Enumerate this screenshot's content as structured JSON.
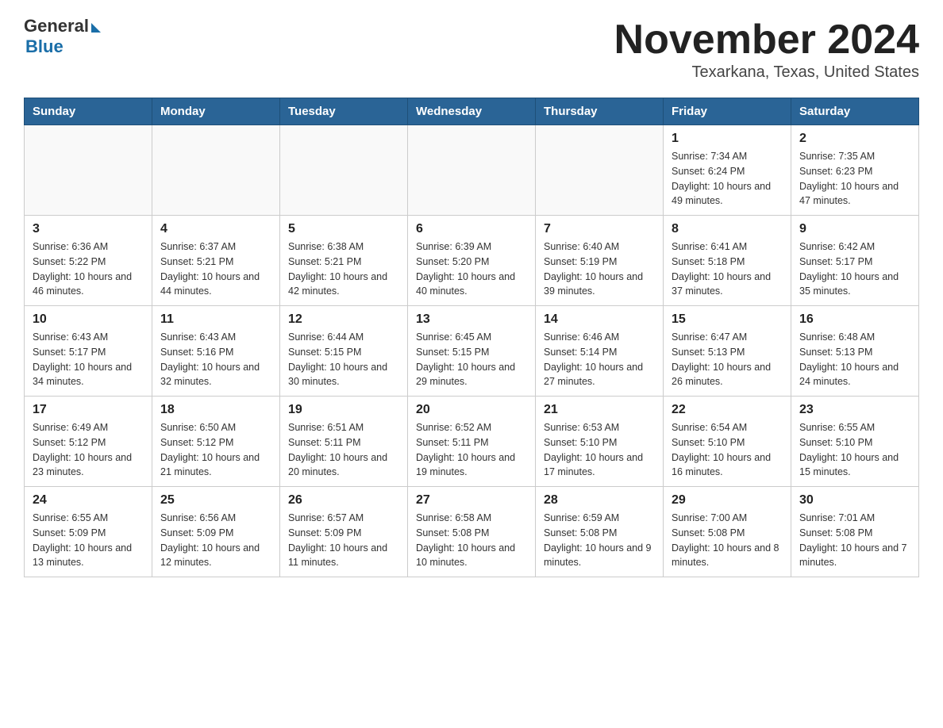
{
  "header": {
    "logo_general": "General",
    "logo_blue": "Blue",
    "month_title": "November 2024",
    "location": "Texarkana, Texas, United States"
  },
  "days_of_week": [
    "Sunday",
    "Monday",
    "Tuesday",
    "Wednesday",
    "Thursday",
    "Friday",
    "Saturday"
  ],
  "weeks": [
    [
      {
        "num": "",
        "sunrise": "",
        "sunset": "",
        "daylight": ""
      },
      {
        "num": "",
        "sunrise": "",
        "sunset": "",
        "daylight": ""
      },
      {
        "num": "",
        "sunrise": "",
        "sunset": "",
        "daylight": ""
      },
      {
        "num": "",
        "sunrise": "",
        "sunset": "",
        "daylight": ""
      },
      {
        "num": "",
        "sunrise": "",
        "sunset": "",
        "daylight": ""
      },
      {
        "num": "1",
        "sunrise": "Sunrise: 7:34 AM",
        "sunset": "Sunset: 6:24 PM",
        "daylight": "Daylight: 10 hours and 49 minutes."
      },
      {
        "num": "2",
        "sunrise": "Sunrise: 7:35 AM",
        "sunset": "Sunset: 6:23 PM",
        "daylight": "Daylight: 10 hours and 47 minutes."
      }
    ],
    [
      {
        "num": "3",
        "sunrise": "Sunrise: 6:36 AM",
        "sunset": "Sunset: 5:22 PM",
        "daylight": "Daylight: 10 hours and 46 minutes."
      },
      {
        "num": "4",
        "sunrise": "Sunrise: 6:37 AM",
        "sunset": "Sunset: 5:21 PM",
        "daylight": "Daylight: 10 hours and 44 minutes."
      },
      {
        "num": "5",
        "sunrise": "Sunrise: 6:38 AM",
        "sunset": "Sunset: 5:21 PM",
        "daylight": "Daylight: 10 hours and 42 minutes."
      },
      {
        "num": "6",
        "sunrise": "Sunrise: 6:39 AM",
        "sunset": "Sunset: 5:20 PM",
        "daylight": "Daylight: 10 hours and 40 minutes."
      },
      {
        "num": "7",
        "sunrise": "Sunrise: 6:40 AM",
        "sunset": "Sunset: 5:19 PM",
        "daylight": "Daylight: 10 hours and 39 minutes."
      },
      {
        "num": "8",
        "sunrise": "Sunrise: 6:41 AM",
        "sunset": "Sunset: 5:18 PM",
        "daylight": "Daylight: 10 hours and 37 minutes."
      },
      {
        "num": "9",
        "sunrise": "Sunrise: 6:42 AM",
        "sunset": "Sunset: 5:17 PM",
        "daylight": "Daylight: 10 hours and 35 minutes."
      }
    ],
    [
      {
        "num": "10",
        "sunrise": "Sunrise: 6:43 AM",
        "sunset": "Sunset: 5:17 PM",
        "daylight": "Daylight: 10 hours and 34 minutes."
      },
      {
        "num": "11",
        "sunrise": "Sunrise: 6:43 AM",
        "sunset": "Sunset: 5:16 PM",
        "daylight": "Daylight: 10 hours and 32 minutes."
      },
      {
        "num": "12",
        "sunrise": "Sunrise: 6:44 AM",
        "sunset": "Sunset: 5:15 PM",
        "daylight": "Daylight: 10 hours and 30 minutes."
      },
      {
        "num": "13",
        "sunrise": "Sunrise: 6:45 AM",
        "sunset": "Sunset: 5:15 PM",
        "daylight": "Daylight: 10 hours and 29 minutes."
      },
      {
        "num": "14",
        "sunrise": "Sunrise: 6:46 AM",
        "sunset": "Sunset: 5:14 PM",
        "daylight": "Daylight: 10 hours and 27 minutes."
      },
      {
        "num": "15",
        "sunrise": "Sunrise: 6:47 AM",
        "sunset": "Sunset: 5:13 PM",
        "daylight": "Daylight: 10 hours and 26 minutes."
      },
      {
        "num": "16",
        "sunrise": "Sunrise: 6:48 AM",
        "sunset": "Sunset: 5:13 PM",
        "daylight": "Daylight: 10 hours and 24 minutes."
      }
    ],
    [
      {
        "num": "17",
        "sunrise": "Sunrise: 6:49 AM",
        "sunset": "Sunset: 5:12 PM",
        "daylight": "Daylight: 10 hours and 23 minutes."
      },
      {
        "num": "18",
        "sunrise": "Sunrise: 6:50 AM",
        "sunset": "Sunset: 5:12 PM",
        "daylight": "Daylight: 10 hours and 21 minutes."
      },
      {
        "num": "19",
        "sunrise": "Sunrise: 6:51 AM",
        "sunset": "Sunset: 5:11 PM",
        "daylight": "Daylight: 10 hours and 20 minutes."
      },
      {
        "num": "20",
        "sunrise": "Sunrise: 6:52 AM",
        "sunset": "Sunset: 5:11 PM",
        "daylight": "Daylight: 10 hours and 19 minutes."
      },
      {
        "num": "21",
        "sunrise": "Sunrise: 6:53 AM",
        "sunset": "Sunset: 5:10 PM",
        "daylight": "Daylight: 10 hours and 17 minutes."
      },
      {
        "num": "22",
        "sunrise": "Sunrise: 6:54 AM",
        "sunset": "Sunset: 5:10 PM",
        "daylight": "Daylight: 10 hours and 16 minutes."
      },
      {
        "num": "23",
        "sunrise": "Sunrise: 6:55 AM",
        "sunset": "Sunset: 5:10 PM",
        "daylight": "Daylight: 10 hours and 15 minutes."
      }
    ],
    [
      {
        "num": "24",
        "sunrise": "Sunrise: 6:55 AM",
        "sunset": "Sunset: 5:09 PM",
        "daylight": "Daylight: 10 hours and 13 minutes."
      },
      {
        "num": "25",
        "sunrise": "Sunrise: 6:56 AM",
        "sunset": "Sunset: 5:09 PM",
        "daylight": "Daylight: 10 hours and 12 minutes."
      },
      {
        "num": "26",
        "sunrise": "Sunrise: 6:57 AM",
        "sunset": "Sunset: 5:09 PM",
        "daylight": "Daylight: 10 hours and 11 minutes."
      },
      {
        "num": "27",
        "sunrise": "Sunrise: 6:58 AM",
        "sunset": "Sunset: 5:08 PM",
        "daylight": "Daylight: 10 hours and 10 minutes."
      },
      {
        "num": "28",
        "sunrise": "Sunrise: 6:59 AM",
        "sunset": "Sunset: 5:08 PM",
        "daylight": "Daylight: 10 hours and 9 minutes."
      },
      {
        "num": "29",
        "sunrise": "Sunrise: 7:00 AM",
        "sunset": "Sunset: 5:08 PM",
        "daylight": "Daylight: 10 hours and 8 minutes."
      },
      {
        "num": "30",
        "sunrise": "Sunrise: 7:01 AM",
        "sunset": "Sunset: 5:08 PM",
        "daylight": "Daylight: 10 hours and 7 minutes."
      }
    ]
  ]
}
